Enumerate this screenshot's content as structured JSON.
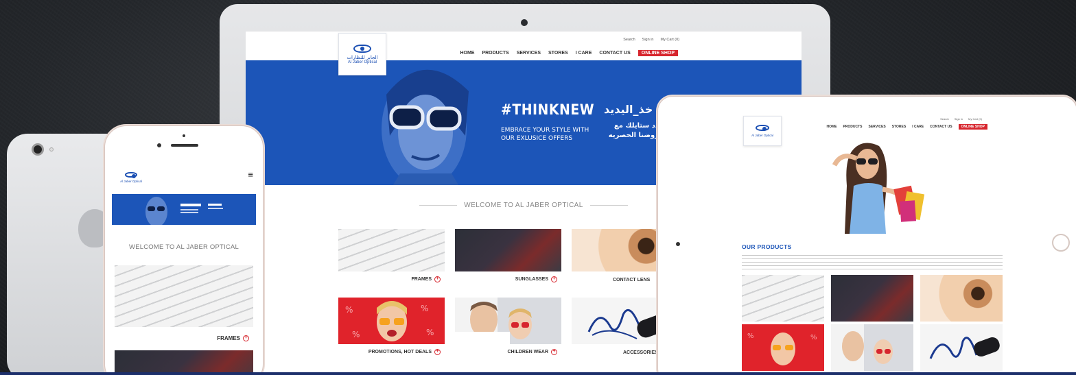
{
  "brand": {
    "name_en": "Al Jaber Optical",
    "name_ar": "الجابر للنظارات",
    "colors": {
      "primary": "#1c55b8",
      "accent": "#d7262e",
      "background": "#24272b"
    }
  },
  "utility_links": [
    "Search",
    "Sign in",
    "My Cart (0)"
  ],
  "nav": {
    "items": [
      "HOME",
      "PRODUCTS",
      "SERVICES",
      "STORES",
      "I CARE",
      "CONTACT US"
    ],
    "shop_label": "ONLINE SHOP"
  },
  "hero": {
    "title": "#THINKNEW",
    "subtitle": "EMBRACE YOUR STYLE WITH OUR EXLUSICE OFFERS",
    "title_ar": "خذ_اليديد",
    "subtitle_ar": "دد ستايلك مع روضنا الحصريه"
  },
  "welcome": "WELCOME TO AL JABER OPTICAL",
  "categories": [
    {
      "label": "FRAMES",
      "icon": "plus-circle-icon"
    },
    {
      "label": "SUNGLASSES",
      "icon": "plus-circle-icon"
    },
    {
      "label": "CONTACT LENS",
      "icon": "plus-circle-icon"
    },
    {
      "label": "PROMOTIONS, HOT DEALS",
      "icon": "plus-circle-icon"
    },
    {
      "label": "CHILDREN WEAR",
      "icon": "plus-circle-icon"
    },
    {
      "label": "ACCESSORIES",
      "icon": "plus-circle-icon"
    }
  ],
  "phone": {
    "menu_icon": "hamburger-menu-icon",
    "tile_label": "FRAMES"
  },
  "tablet": {
    "heading": "OUR PRODUCTS"
  }
}
